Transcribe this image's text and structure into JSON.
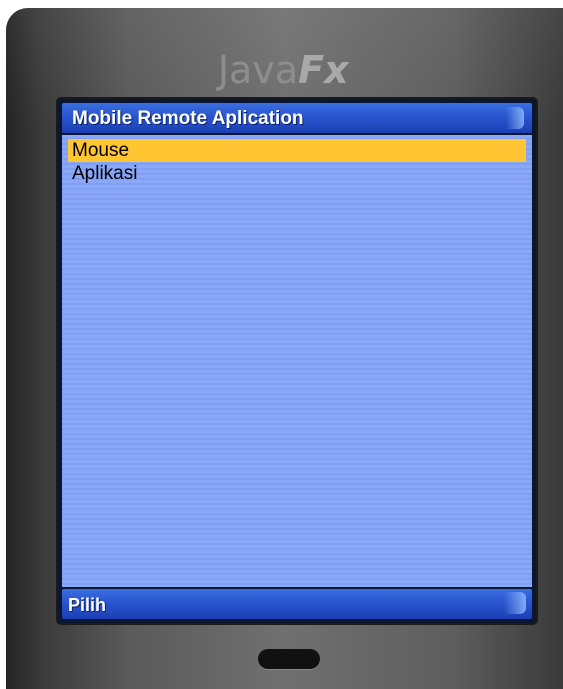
{
  "brand": {
    "prefix": "Java",
    "suffix": "Fx",
    "tm": "·"
  },
  "screen": {
    "title": "Mobile Remote Aplication",
    "list": [
      {
        "label": "Mouse",
        "selected": true
      },
      {
        "label": "Aplikasi",
        "selected": false
      }
    ],
    "softkey_left": "Pilih"
  },
  "colors": {
    "title_bar": "#2a55cf",
    "content_bg": "#89a6f6",
    "selection": "#ffc532",
    "device_body": "#5a5a5a"
  },
  "icons": {
    "home_key": "oval-home-button"
  }
}
